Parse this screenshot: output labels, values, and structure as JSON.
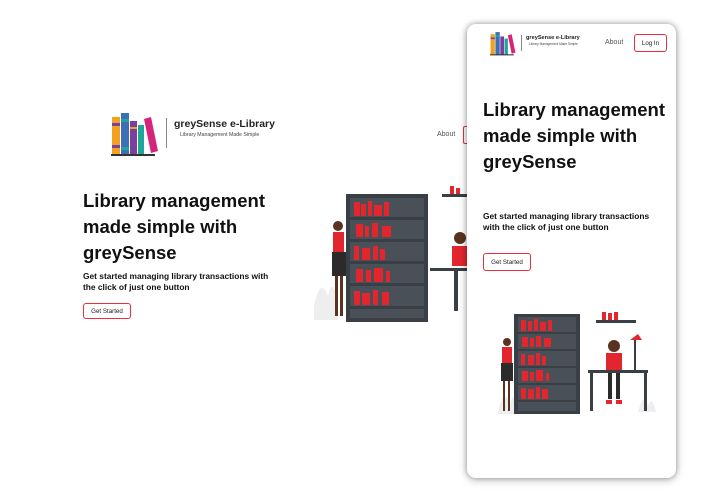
{
  "desktop": {
    "brand": {
      "title": "greySense e-Library",
      "tagline": "Library Management Made Simple"
    },
    "nav": {
      "about_label": "About"
    },
    "hero": {
      "heading": "Library management made simple with greySense",
      "subheading": "Get started managing library transactions with the click of just one button",
      "cta_label": "Get Started"
    }
  },
  "mobile": {
    "brand": {
      "title": "greySense e-Library",
      "tagline": "Library Management Made Simple"
    },
    "nav": {
      "about_label": "About",
      "login_label": "Log In"
    },
    "hero": {
      "heading": "Library management made simple with greySense",
      "subheading_line1": "Get started managing library transactions",
      "subheading_line2": "with the click of just one button",
      "cta_label": "Get Started"
    }
  },
  "colors": {
    "accent": "#e8313d",
    "shelf": "#3a3f45",
    "book_red": "#e3262e",
    "logo_orange": "#f2a21e",
    "logo_blue": "#3d6fb6",
    "logo_magenta": "#d6247d",
    "logo_teal": "#1fa59a",
    "logo_purple": "#7b3fa0"
  },
  "icons": {
    "logo": "books-logo-icon",
    "illustration": "library-people-illustration"
  }
}
